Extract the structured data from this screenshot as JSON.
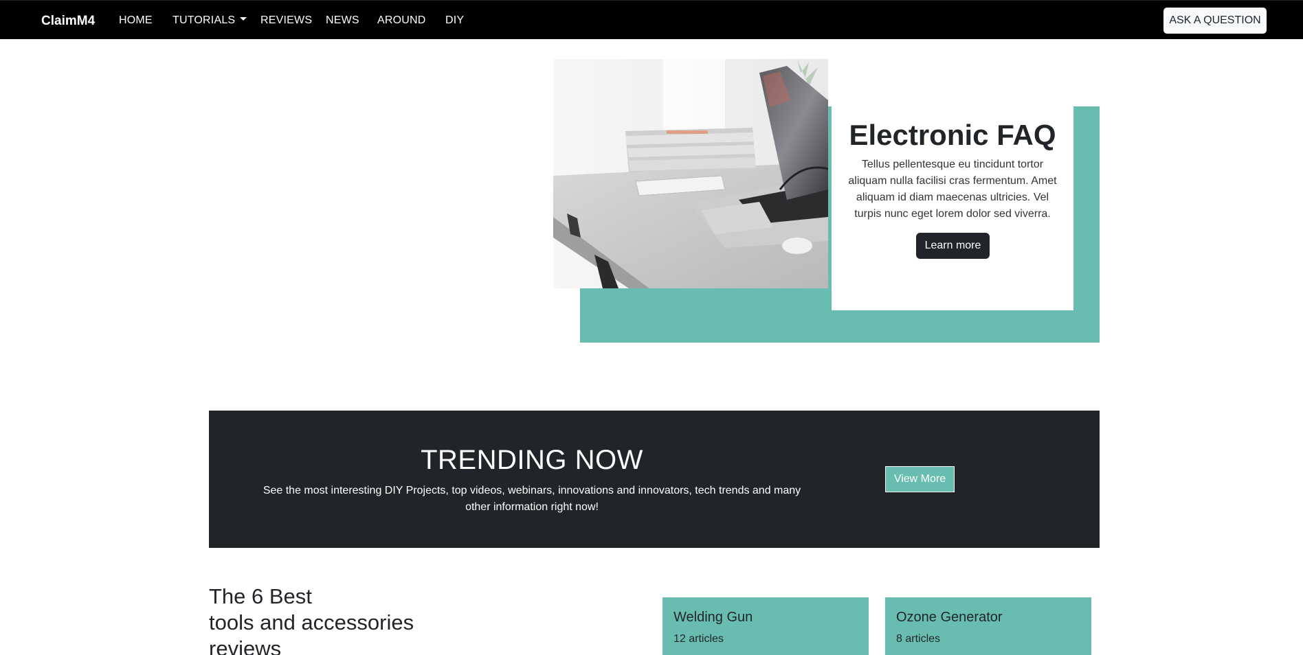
{
  "navbar": {
    "brand": "ClaimM4",
    "links": [
      "HOME",
      "TUTORIALS",
      "REVIEWS",
      "NEWS",
      "AROUND",
      "DIY"
    ],
    "ask_label": "ASK A QUESTION"
  },
  "hero": {
    "title": "Electronic FAQ",
    "text": "Tellus pellentesque eu tincidunt tortor aliquam nulla facilisi cras fermentum. Amet aliquam id diam maecenas ultricies. Vel turpis nunc eget lorem dolor sed viverra.",
    "button": "Learn more"
  },
  "trending": {
    "title": "TRENDING NOW",
    "text": "See the most interesting DIY Projects, top videos, webinars, innovations and innovators, tech trends and many other information right now!",
    "button": "View More"
  },
  "best": {
    "line1": "The 6 Best",
    "line2": "tools and accessories",
    "line3": "reviews",
    "cards": [
      {
        "title": "Welding Gun",
        "count": "12 articles"
      },
      {
        "title": "Ozone Generator",
        "count": "8 articles"
      }
    ]
  },
  "colors": {
    "accent": "#68bdb0",
    "dark": "#212529",
    "navbar": "#000000"
  }
}
